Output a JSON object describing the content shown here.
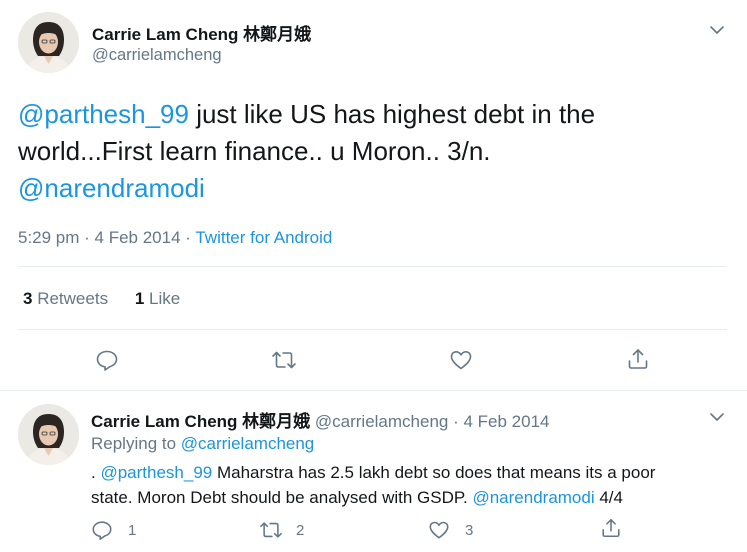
{
  "main_tweet": {
    "author_name": "Carrie Lam Cheng 林鄭月娥",
    "handle": "@carrielamcheng",
    "text": {
      "mention1": "@parthesh_99",
      "line1_rest": " just like US has highest debt in the",
      "line2": "world...First learn finance.. u Moron..  3/n.",
      "mention2": "@narendramodi"
    },
    "time": "5:29 pm · 4 Feb 2014",
    "separator": " · ",
    "source": "Twitter for Android",
    "stats": {
      "retweets_count": "3",
      "retweets_label": "Retweets",
      "likes_count": "1",
      "likes_label": "Like"
    }
  },
  "reply_tweet": {
    "author_name": "Carrie Lam Cheng 林鄭月娥",
    "handle": "@carrielamcheng",
    "sep_dot": " · ",
    "date": "4 Feb 2014",
    "replying_label": "Replying to ",
    "replying_to": "@carrielamcheng",
    "text": {
      "prefix": ". ",
      "mention1": "@parthesh_99",
      "rest1": " Maharstra has 2.5 lakh debt so does that means its a poor",
      "line2_start": "state. Moron Debt should be analysed with GSDP. ",
      "mention2": "@narendramodi",
      "suffix": "  4/4"
    },
    "actions": {
      "reply_count": "1",
      "retweet_count": "2",
      "like_count": "3"
    }
  },
  "icons": {
    "menu": "chevron-down-icon",
    "reply": "reply-icon",
    "retweet": "retweet-icon",
    "like": "heart-icon",
    "share": "share-icon"
  },
  "colors": {
    "link": "#1b95e0",
    "muted": "#657786",
    "text": "#14171a",
    "divider": "#e6ecf0"
  }
}
